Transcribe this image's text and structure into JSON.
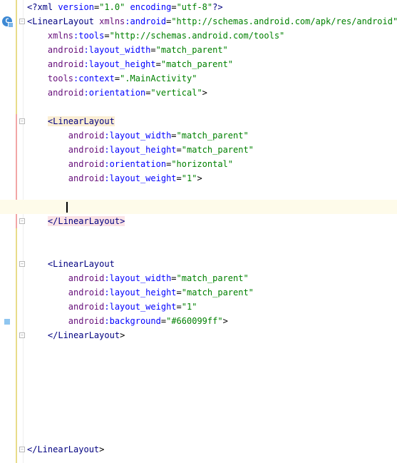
{
  "editor": {
    "lines": [
      "<?xml version=\"1.0\" encoding=\"utf-8\"?>",
      "<LinearLayout xmlns:android=\"http://schemas.android.com/apk/res/android\"",
      "    xmlns:tools=\"http://schemas.android.com/tools\"",
      "    android:layout_width=\"match_parent\"",
      "    android:layout_height=\"match_parent\"",
      "    tools:context=\".MainActivity\"",
      "    android:orientation=\"vertical\">",
      "",
      "    <LinearLayout",
      "        android:layout_width=\"match_parent\"",
      "        android:layout_height=\"match_parent\"",
      "        android:orientation=\"horizontal\"",
      "        android:layout_weight=\"1\">",
      "",
      "",
      "    </LinearLayout>",
      "",
      "",
      "    <LinearLayout",
      "        android:layout_width=\"match_parent\"",
      "        android:layout_height=\"match_parent\"",
      "        android:layout_weight=\"1\"",
      "        android:background=\"#660099ff\">",
      "    </LinearLayout>",
      "",
      "",
      "",
      "",
      "",
      "",
      "",
      "</LinearLayout>"
    ],
    "current_line": 15,
    "colors": {
      "tag": "#000080",
      "namespace": "#660e7a",
      "attribute": "#0000ff",
      "value": "#008000",
      "current_line_bg": "#fefbea",
      "swatch": "#660099ff"
    },
    "gutter_icons": [
      "activity-icon",
      "color-swatch-icon"
    ]
  }
}
